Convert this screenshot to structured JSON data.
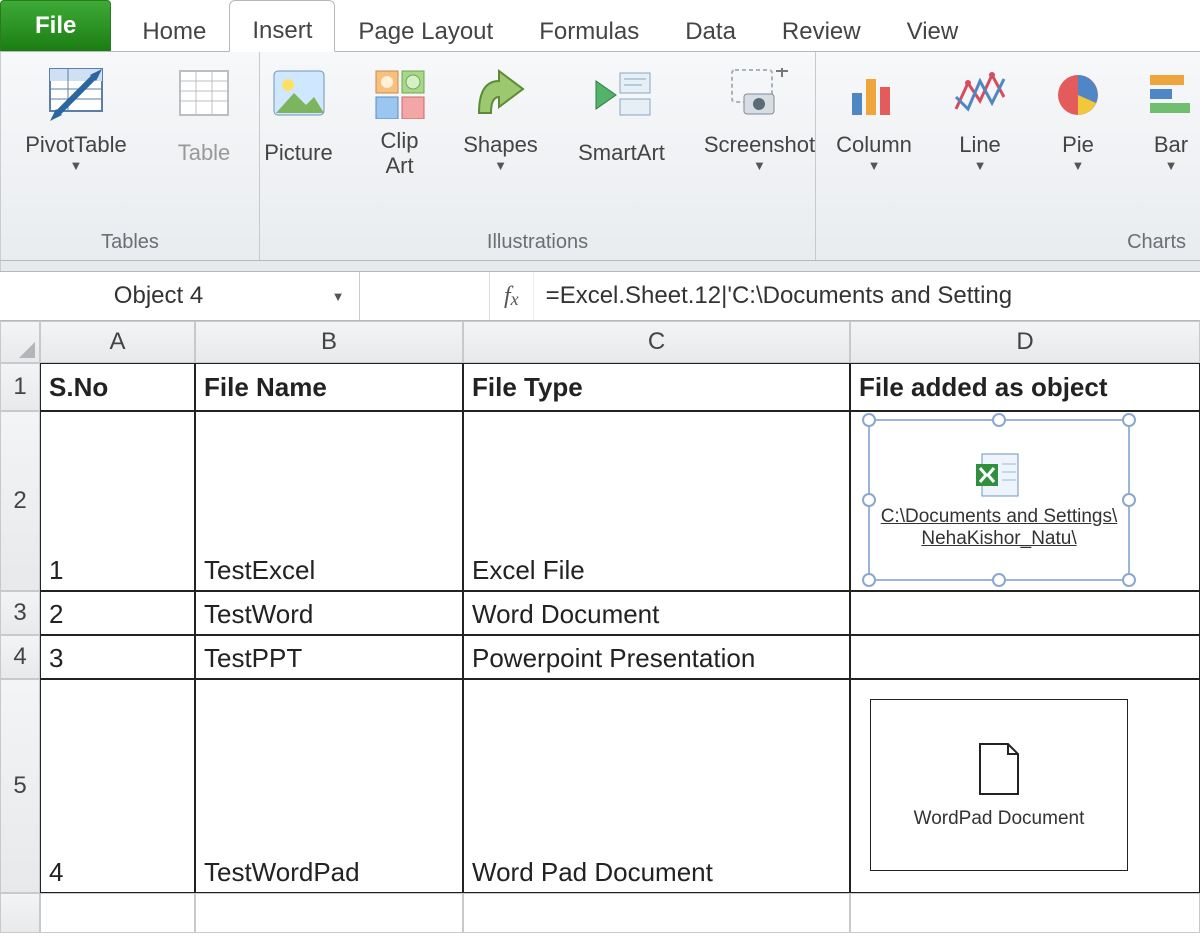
{
  "tabs": {
    "file": "File",
    "home": "Home",
    "insert": "Insert",
    "page_layout": "Page Layout",
    "formulas": "Formulas",
    "data": "Data",
    "review": "Review",
    "view": "View"
  },
  "ribbon": {
    "tables_group": "Tables",
    "pivot_table": "PivotTable",
    "table": "Table",
    "illustrations_group": "Illustrations",
    "picture": "Picture",
    "clip_art_l1": "Clip",
    "clip_art_l2": "Art",
    "shapes": "Shapes",
    "smartart": "SmartArt",
    "screenshot": "Screenshot",
    "charts_group": "Charts",
    "column": "Column",
    "line": "Line",
    "pie": "Pie",
    "bar": "Bar"
  },
  "name_box": "Object 4",
  "fx_label": "fx",
  "formula": "=Excel.Sheet.12|'C:\\Documents and Setting",
  "columns": {
    "A": "A",
    "B": "B",
    "C": "C",
    "D": "D"
  },
  "rows": {
    "r1": "1",
    "r2": "2",
    "r3": "3",
    "r4": "4",
    "r5": "5"
  },
  "headers": {
    "sno": "S.No",
    "fname": "File Name",
    "ftype": "File Type",
    "fobj": "File added as object"
  },
  "data_rows": [
    {
      "sno": "1",
      "fname": "TestExcel",
      "ftype": "Excel File"
    },
    {
      "sno": "2",
      "fname": "TestWord",
      "ftype": "Word Document"
    },
    {
      "sno": "3",
      "fname": "TestPPT",
      "ftype": "Powerpoint Presentation"
    },
    {
      "sno": "4",
      "fname": "TestWordPad",
      "ftype": "Word Pad Document"
    }
  ],
  "embedded": {
    "excel_caption": "C:\\Documents and Settings\\ NehaKishor_Natu\\",
    "wordpad_caption": "WordPad Document"
  }
}
